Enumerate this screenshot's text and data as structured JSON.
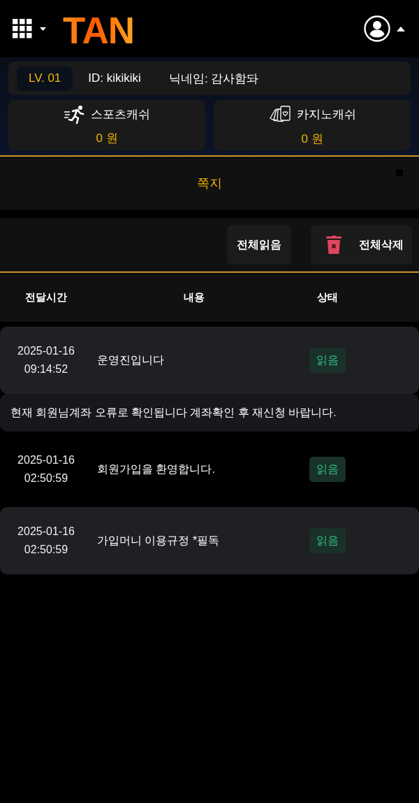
{
  "header": {
    "logo": "TAN"
  },
  "account": {
    "level": "LV. 01",
    "id": "ID: kikikiki",
    "nickname": "닉네임: 감사함돠"
  },
  "wallets": [
    {
      "kind": "sports",
      "label": "스포츠캐쉬",
      "amount": "0 원"
    },
    {
      "kind": "casino",
      "label": "카지노캐쉬",
      "amount": "0 원"
    }
  ],
  "page_title": "쪽지",
  "toolbar": {
    "buttons": [
      {
        "kind": "read",
        "label": "전체읽음"
      },
      {
        "kind": "delete",
        "label": "전체삭제"
      }
    ]
  },
  "table": {
    "columns": [
      "전달시간",
      "내용",
      "상태"
    ],
    "rows": [
      {
        "date": "2025-01-16",
        "time": "09:14:52",
        "title": "운영진입니다",
        "status": "읽음",
        "expanded": true,
        "body": "현재 회원님계좌 오류로 확인됩니다 계좌확인 후 재신청 바랍니다."
      },
      {
        "date": "2025-01-16",
        "time": "02:50:59",
        "title": "회원가입을 환영합니다.",
        "status": "읽음",
        "expanded": false
      },
      {
        "date": "2025-01-16",
        "time": "02:50:59",
        "title": "가입머니 이용규정 *필독",
        "status": "읽음",
        "expanded": false
      }
    ]
  }
}
